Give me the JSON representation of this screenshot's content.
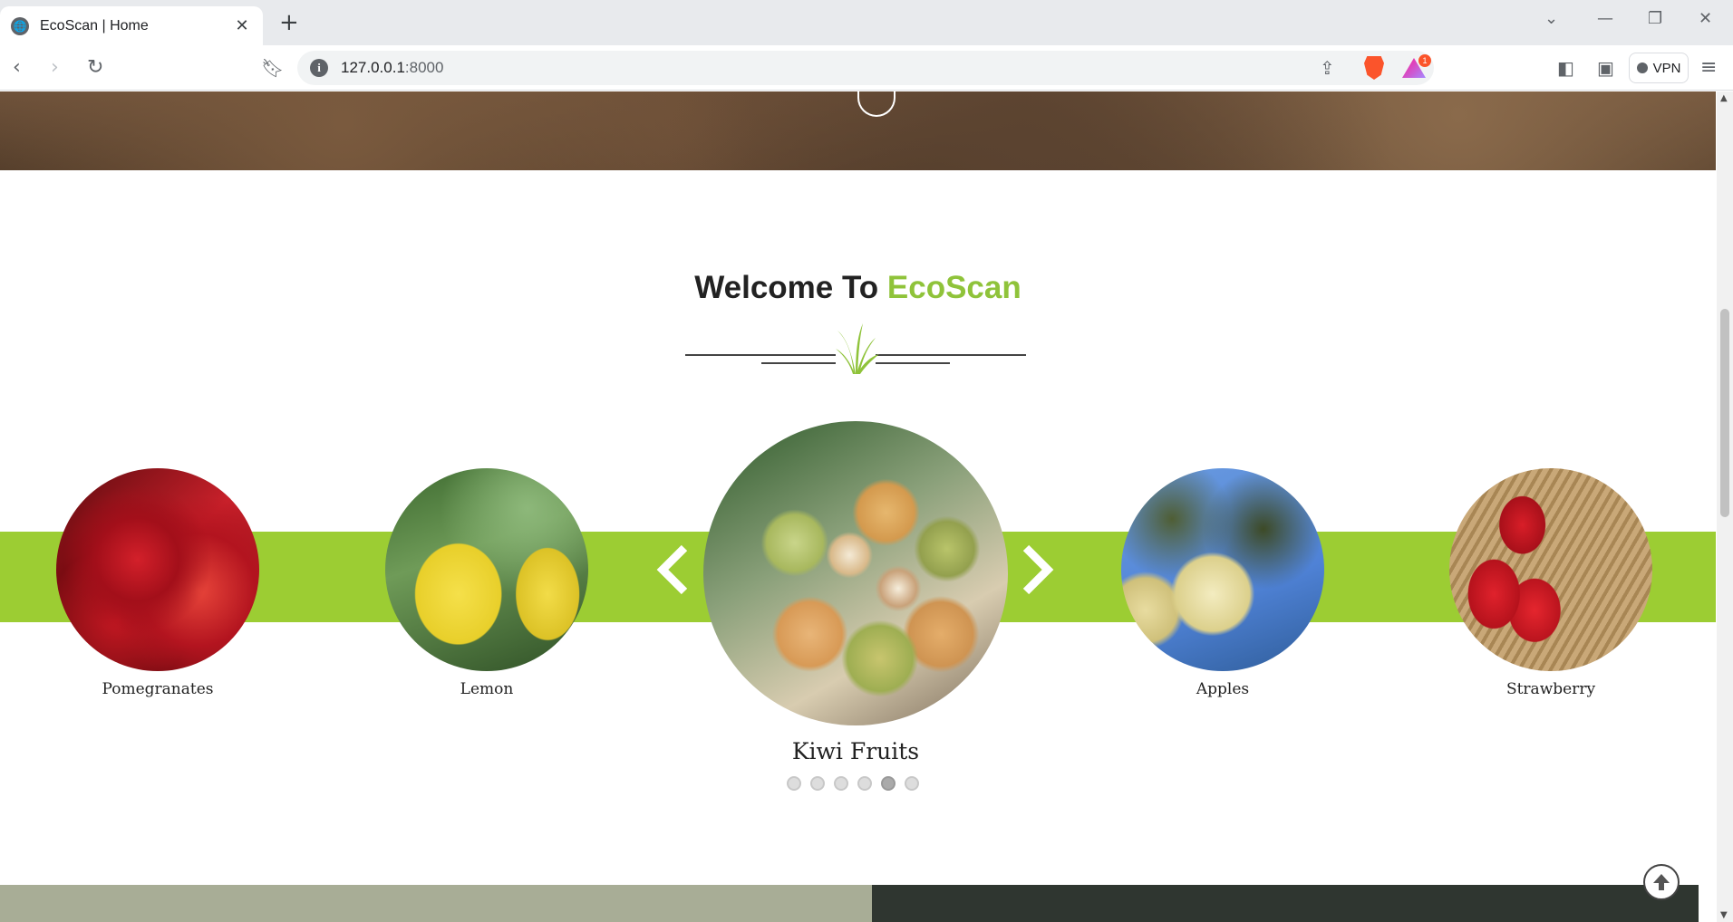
{
  "browser": {
    "tab_title": "EcoScan | Home",
    "tab_close": "✕",
    "new_tab": "+",
    "url_host": "127.0.0.1",
    "url_port": ":8000",
    "vpn_label": "VPN",
    "notification_count": "1"
  },
  "welcome": {
    "prefix": "Welcome To ",
    "brand": "EcoScan"
  },
  "carousel": {
    "items": [
      {
        "label": "Pomegranates"
      },
      {
        "label": "Lemon"
      },
      {
        "label": "Kiwi Fruits"
      },
      {
        "label": "Apples"
      },
      {
        "label": "Strawberry"
      }
    ],
    "dot_count": 6,
    "active_dot": 5
  },
  "colors": {
    "brand_green": "#8fc33a",
    "band_green": "#9ccd33"
  }
}
